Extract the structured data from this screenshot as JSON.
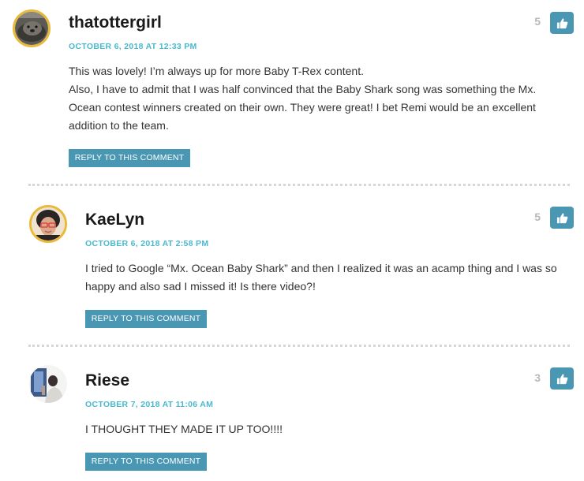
{
  "comments": [
    {
      "author": "thatottergirl",
      "timestamp": "OCTOBER 6, 2018 AT 12:33 PM",
      "paragraphs": [
        "This was lovely! I’m always up for more Baby T-Rex content.",
        "Also, I have to admit that I was half convinced that the Baby Shark song was something the Mx. Ocean contest winners created on their own. They were great! I bet Remi would be an excellent addition to the team."
      ],
      "reply_label": "REPLY TO THIS COMMENT",
      "votes": "5"
    },
    {
      "author": "KaeLyn",
      "timestamp": "OCTOBER 6, 2018 AT 2:58 PM",
      "paragraphs": [
        "I tried to Google “Mx. Ocean Baby Shark” and then I realized it was an acamp thing and I was so happy and also sad I missed it! Is there video?!"
      ],
      "reply_label": "REPLY TO THIS COMMENT",
      "votes": "5"
    },
    {
      "author": "Riese",
      "timestamp": "OCTOBER 7, 2018 AT 11:06 AM",
      "paragraphs": [
        "I THOUGHT THEY MADE IT UP TOO!!!!"
      ],
      "reply_label": "REPLY TO THIS COMMENT",
      "votes": "3"
    }
  ],
  "colors": {
    "accent": "#4a97b4",
    "timestamp": "#49b9cf",
    "avatar_ring": "#e8b93b",
    "vote_count": "#b9b9b9"
  },
  "icons": {
    "like": "thumbs-up-icon"
  }
}
